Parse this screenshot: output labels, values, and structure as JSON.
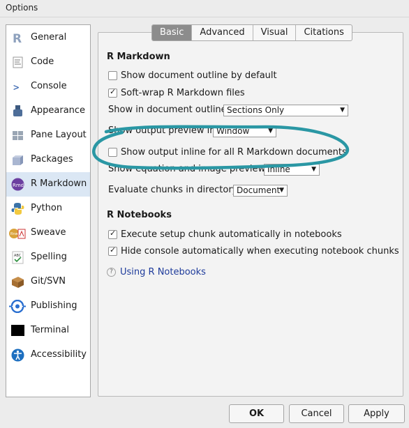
{
  "window": {
    "title": "Options"
  },
  "sidebar": {
    "items": [
      {
        "label": "General",
        "icon": "r-logo-icon"
      },
      {
        "label": "Code",
        "icon": "code-icon"
      },
      {
        "label": "Console",
        "icon": "console-icon"
      },
      {
        "label": "Appearance",
        "icon": "appearance-icon"
      },
      {
        "label": "Pane Layout",
        "icon": "pane-layout-icon"
      },
      {
        "label": "Packages",
        "icon": "packages-icon"
      },
      {
        "label": "R Markdown",
        "icon": "rmd-icon",
        "active": true
      },
      {
        "label": "Python",
        "icon": "python-icon"
      },
      {
        "label": "Sweave",
        "icon": "sweave-icon"
      },
      {
        "label": "Spelling",
        "icon": "spelling-icon"
      },
      {
        "label": "Git/SVN",
        "icon": "git-icon"
      },
      {
        "label": "Publishing",
        "icon": "publishing-icon"
      },
      {
        "label": "Terminal",
        "icon": "terminal-icon"
      },
      {
        "label": "Accessibility",
        "icon": "accessibility-icon"
      }
    ]
  },
  "tabs": [
    {
      "label": "Basic",
      "active": true
    },
    {
      "label": "Advanced"
    },
    {
      "label": "Visual"
    },
    {
      "label": "Citations"
    }
  ],
  "rmarkdown": {
    "title": "R Markdown",
    "show_outline": {
      "label": "Show document outline by default",
      "checked": false
    },
    "soft_wrap": {
      "label": "Soft-wrap R Markdown files",
      "checked": true
    },
    "outline_show": {
      "label": "Show in document outline:",
      "value": "Sections Only"
    },
    "preview_in": {
      "label": "Show output preview in:",
      "value": "Window"
    },
    "inline_output": {
      "label": "Show output inline for all R Markdown documents",
      "checked": false
    },
    "equation_previews": {
      "label": "Show equation and image previews:",
      "value": "Inline"
    },
    "eval_dir": {
      "label": "Evaluate chunks in directory:",
      "value": "Document"
    }
  },
  "notebooks": {
    "title": "R Notebooks",
    "setup_chunk": {
      "label": "Execute setup chunk automatically in notebooks",
      "checked": true
    },
    "hide_console": {
      "label": "Hide console automatically when executing notebook chunks",
      "checked": true
    },
    "help_link": "Using R Notebooks"
  },
  "buttons": {
    "ok": "OK",
    "cancel": "Cancel",
    "apply": "Apply"
  },
  "colors": {
    "annotation": "#2a97a4",
    "active_tab": "#8c8c8c",
    "active_sidebar": "#dbe7f4",
    "link": "#1e3b9b"
  }
}
